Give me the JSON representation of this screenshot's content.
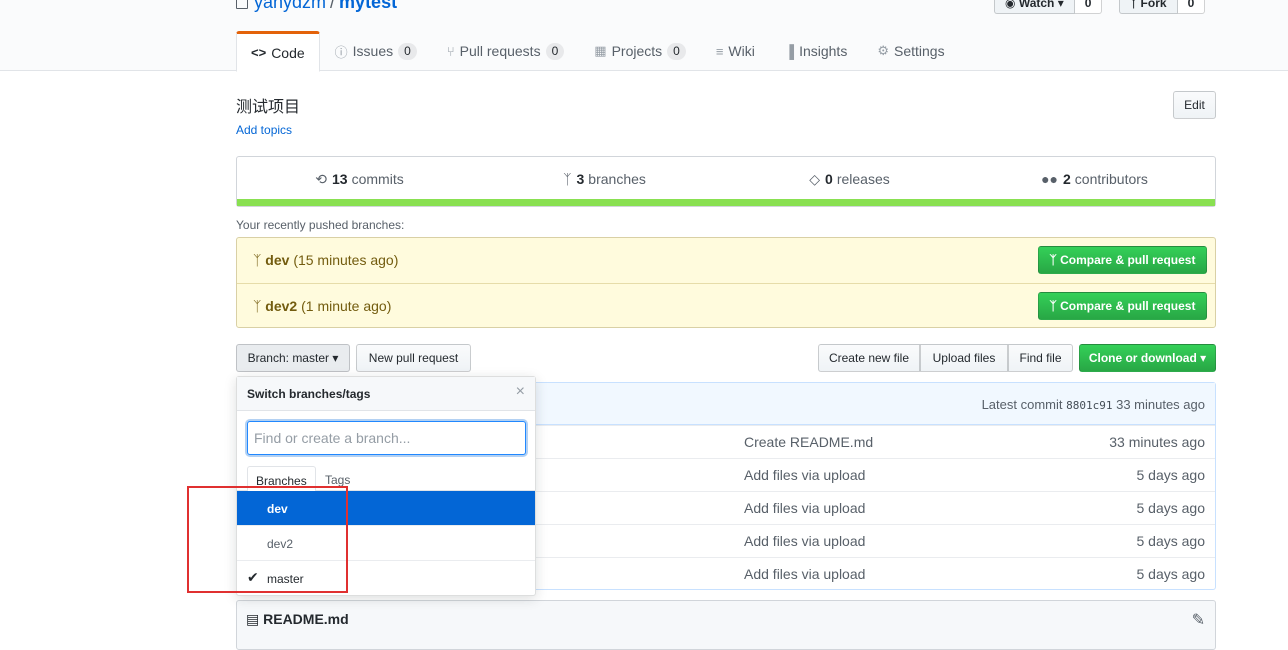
{
  "repo": {
    "owner": "yanydzm",
    "separator": "/",
    "name": "mytest"
  },
  "social": {
    "watch_label": "Watch ▾",
    "watch_count": "0",
    "fork_label": "Fork",
    "fork_count": "0"
  },
  "tabs": [
    {
      "icon": "<>",
      "label": "Code",
      "count": null
    },
    {
      "icon": "ⓘ",
      "label": "Issues",
      "count": "0"
    },
    {
      "icon": "⑂",
      "label": "Pull requests",
      "count": "0"
    },
    {
      "icon": "▦",
      "label": "Projects",
      "count": "0"
    },
    {
      "icon": "≡",
      "label": "Wiki",
      "count": null
    },
    {
      "icon": "▐",
      "label": "Insights",
      "count": null
    },
    {
      "icon": "⚙",
      "label": "Settings",
      "count": null
    }
  ],
  "description": "测试项目",
  "add_topics": "Add topics",
  "edit_label": "Edit",
  "summary": {
    "commits_count": "13",
    "commits_label": "commits",
    "branches_count": "3",
    "branches_label": "branches",
    "releases_count": "0",
    "releases_label": "releases",
    "contributors_count": "2",
    "contributors_label": "contributors",
    "language_color": "#89e051"
  },
  "recent": {
    "label": "Your recently pushed branches:",
    "branches": [
      {
        "name": "dev",
        "time": "(15 minutes ago)",
        "button": "Compare & pull request"
      },
      {
        "name": "dev2",
        "time": "(1 minute ago)",
        "button": "Compare & pull request"
      }
    ]
  },
  "toolbar": {
    "branch_button": "Branch: master ▾",
    "new_pr": "New pull request",
    "create_file": "Create new file",
    "upload_files": "Upload files",
    "find_file": "Find file",
    "clone": "Clone or download ▾"
  },
  "commit_bar": {
    "latest_label": "Latest commit",
    "sha": "8801c91",
    "age": "33 minutes ago"
  },
  "files": [
    {
      "message": "Create README.md",
      "age": "33 minutes ago"
    },
    {
      "message": "Add files via upload",
      "age": "5 days ago"
    },
    {
      "message": "Add files via upload",
      "age": "5 days ago"
    },
    {
      "message": "Add files via upload",
      "age": "5 days ago"
    },
    {
      "message": "Add files via upload",
      "age": "5 days ago"
    }
  ],
  "readme": {
    "title": "README.md"
  },
  "dropdown": {
    "title": "Switch branches/tags",
    "close": "×",
    "placeholder": "Find or create a branch...",
    "tab_branches": "Branches",
    "tab_tags": "Tags",
    "items": [
      {
        "name": "dev"
      },
      {
        "name": "dev2"
      },
      {
        "name": "master",
        "check": "✔"
      }
    ]
  },
  "colors": {
    "accent": "#0366d6",
    "green": "#28a745",
    "highlight": "#e03030",
    "tab_active": "#e36209"
  }
}
